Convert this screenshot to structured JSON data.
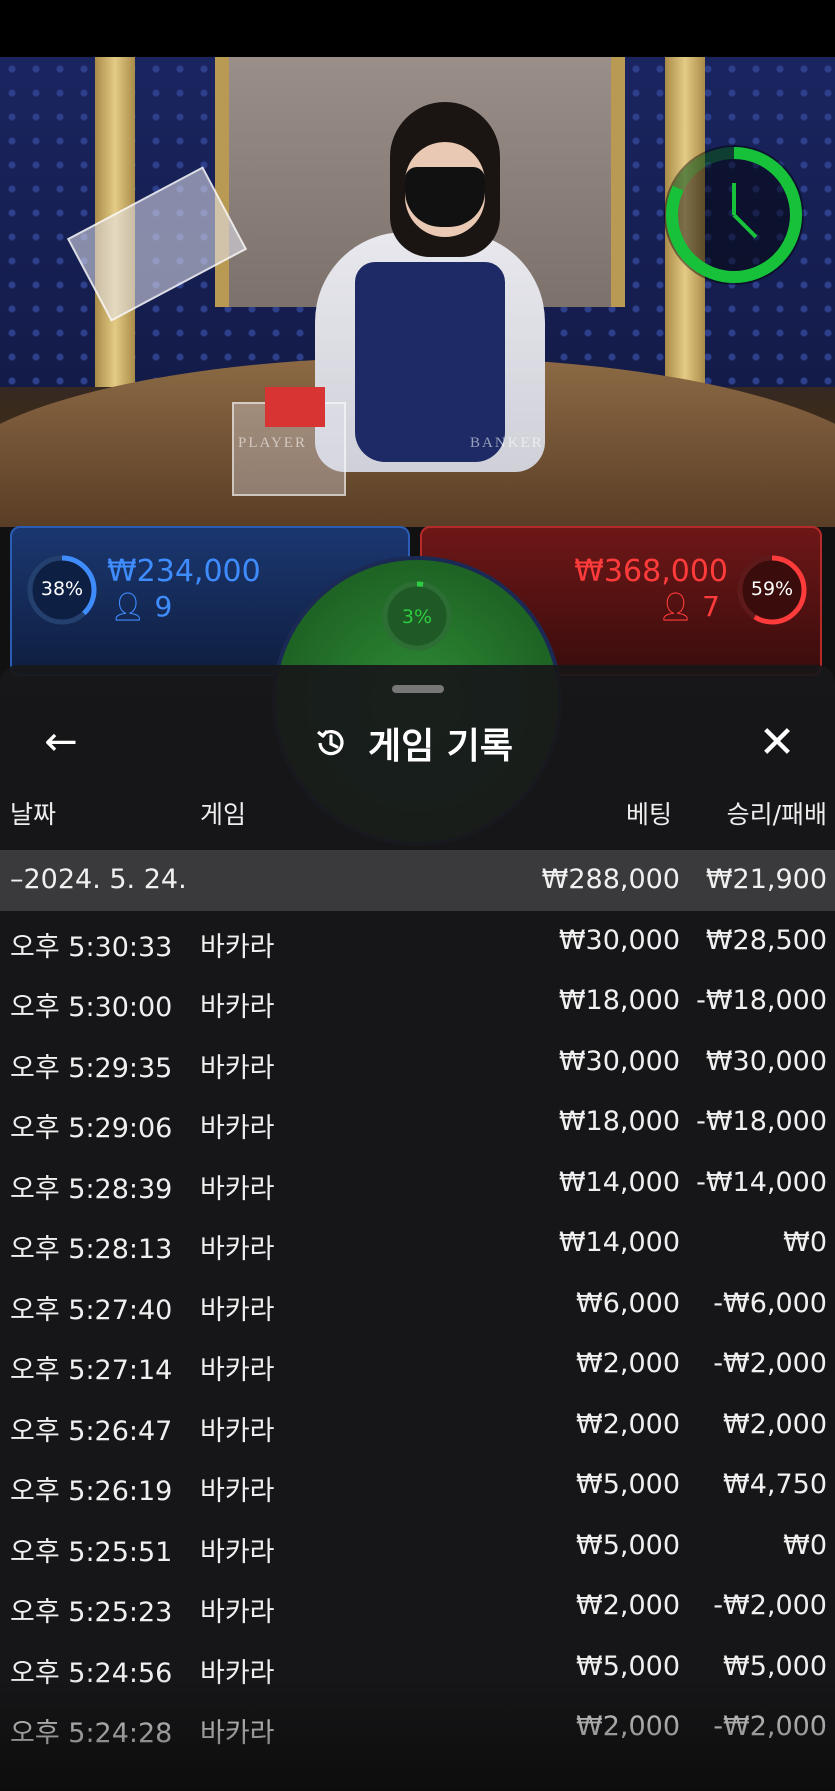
{
  "video": {
    "table_labels": {
      "player": "PLAYER",
      "banker": "BANKER"
    },
    "timer": {
      "color": "#17c23a",
      "progress": 0.82
    }
  },
  "bets": {
    "player": {
      "percent": "38%",
      "amount": "₩234,000",
      "count": "9",
      "color": "#3f8cff",
      "ring_fill": 0.38
    },
    "tie": {
      "percent": "3%",
      "color": "#2ecc40"
    },
    "banker": {
      "percent": "59%",
      "amount": "₩368,000",
      "count": "7",
      "color": "#ff3b3b",
      "ring_fill": 0.59
    }
  },
  "history": {
    "title": "게임 기록",
    "back_icon": "arrow-left-icon",
    "history_icon": "history-icon",
    "close_icon": "close-icon",
    "columns": {
      "date": "날짜",
      "game": "게임",
      "bet": "베팅",
      "result": "승리/패배"
    },
    "date_group": {
      "label": "–2024. 5. 24.",
      "bet": "₩288,000",
      "result": "₩21,900"
    },
    "rows": [
      {
        "time": "오후 5:30:33",
        "game": "바카라",
        "bet": "₩30,000",
        "result": "₩28,500"
      },
      {
        "time": "오후 5:30:00",
        "game": "바카라",
        "bet": "₩18,000",
        "result": "-₩18,000"
      },
      {
        "time": "오후 5:29:35",
        "game": "바카라",
        "bet": "₩30,000",
        "result": "₩30,000"
      },
      {
        "time": "오후 5:29:06",
        "game": "바카라",
        "bet": "₩18,000",
        "result": "-₩18,000"
      },
      {
        "time": "오후 5:28:39",
        "game": "바카라",
        "bet": "₩14,000",
        "result": "-₩14,000"
      },
      {
        "time": "오후 5:28:13",
        "game": "바카라",
        "bet": "₩14,000",
        "result": "₩0"
      },
      {
        "time": "오후 5:27:40",
        "game": "바카라",
        "bet": "₩6,000",
        "result": "-₩6,000"
      },
      {
        "time": "오후 5:27:14",
        "game": "바카라",
        "bet": "₩2,000",
        "result": "-₩2,000"
      },
      {
        "time": "오후 5:26:47",
        "game": "바카라",
        "bet": "₩2,000",
        "result": "₩2,000"
      },
      {
        "time": "오후 5:26:19",
        "game": "바카라",
        "bet": "₩5,000",
        "result": "₩4,750"
      },
      {
        "time": "오후 5:25:51",
        "game": "바카라",
        "bet": "₩5,000",
        "result": "₩0"
      },
      {
        "time": "오후 5:25:23",
        "game": "바카라",
        "bet": "₩2,000",
        "result": "-₩2,000"
      },
      {
        "time": "오후 5:24:56",
        "game": "바카라",
        "bet": "₩5,000",
        "result": "₩5,000"
      },
      {
        "time": "오후 5:24:28",
        "game": "바카라",
        "bet": "₩2,000",
        "result": "-₩2,000"
      }
    ]
  }
}
